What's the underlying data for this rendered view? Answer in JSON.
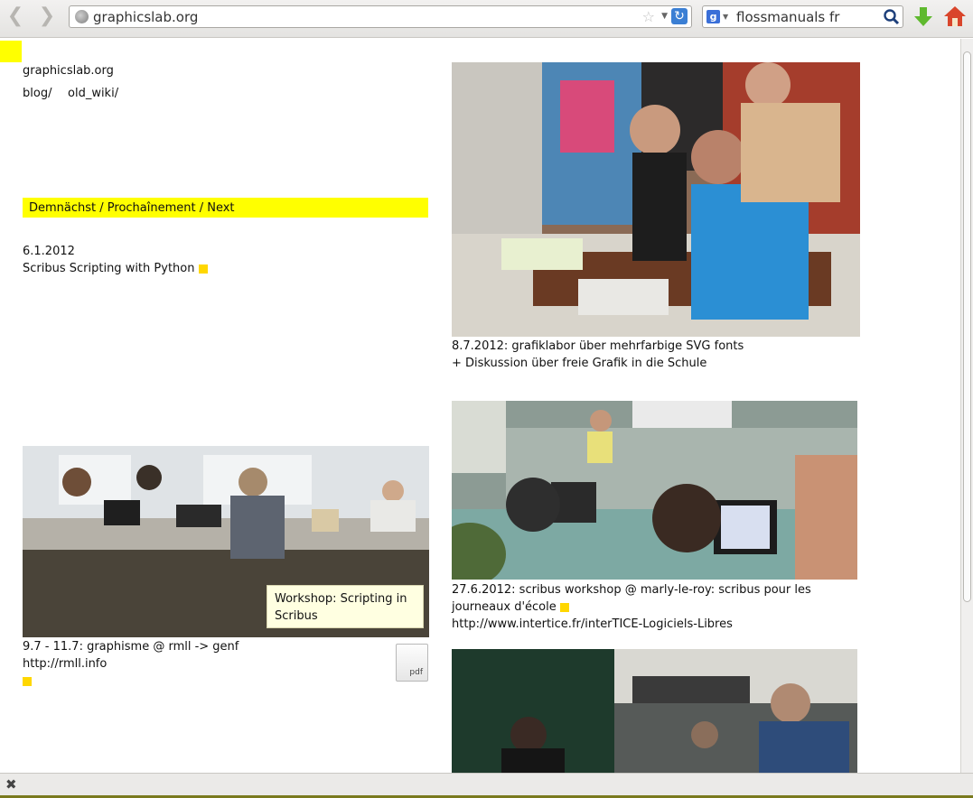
{
  "browser": {
    "url": "graphicslab.org",
    "search_query": "flossmanuals fr",
    "search_engine_glyph": "g",
    "back_glyph": "❮",
    "forward_glyph": "❯",
    "reload_glyph": "↻",
    "star_glyph": "☆",
    "dropdown_glyph": "▼",
    "close_glyph": "✖"
  },
  "site": {
    "title": "graphicslab.org",
    "nav": [
      "blog/",
      "old_wiki/"
    ]
  },
  "banner": "Demnächst / Prochaînement / Next",
  "upcoming": {
    "date": "6.1.2012",
    "title": "Scribus Scripting with Python"
  },
  "posts": [
    {
      "lines": [
        "8.7.2012: grafiklabor über mehrfarbige SVG fonts",
        "+ Diskussion über freie Grafik in die Schule"
      ]
    },
    {
      "lines": [
        "27.6.2012: scribus workshop @ marly-le-roy: scribus pour les",
        "journeaux d'école"
      ],
      "link": "http://www.intertice.fr/interTICE-Logiciels-Libres"
    },
    {
      "lines": [
        "9.7 - 11.7: graphisme @ rmll -> genf"
      ],
      "link": "http://rmll.info"
    }
  ],
  "tooltip": "Workshop: Scripting in Scribus",
  "pdf_label": "pdf",
  "colors": {
    "highlight": "#ffff00",
    "marker": "#ffd700"
  }
}
